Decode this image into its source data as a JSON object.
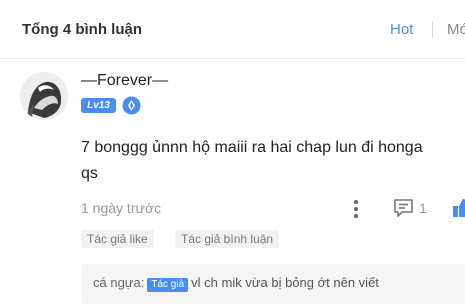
{
  "header": {
    "title": "Tổng 4 bình luận",
    "sort_hot": "Hot",
    "sort_more": "Mới"
  },
  "comment": {
    "username": "—Forever—",
    "level": "Lv13",
    "content_line1": "7 bonggg ủnnn hộ maiii ra hai chap lun đi honga",
    "content_line2": "qs",
    "time": "1 ngày trước",
    "reply_count": "1",
    "tags": [
      "Tác giả like",
      "Tác giả bình luận"
    ],
    "icons": {
      "more": "more-vertical-icon",
      "reply": "comment-icon",
      "like": "thumbs-up-icon",
      "medal": "medal-icon"
    }
  },
  "reply": {
    "author": "cá ngựa:",
    "badge": "Tác giả",
    "text": "vl ch mik vừa bị bỏng ớt nên viết"
  },
  "colors": {
    "accent": "#4a90e2",
    "badge": "#4a8df0",
    "muted": "#999999"
  }
}
